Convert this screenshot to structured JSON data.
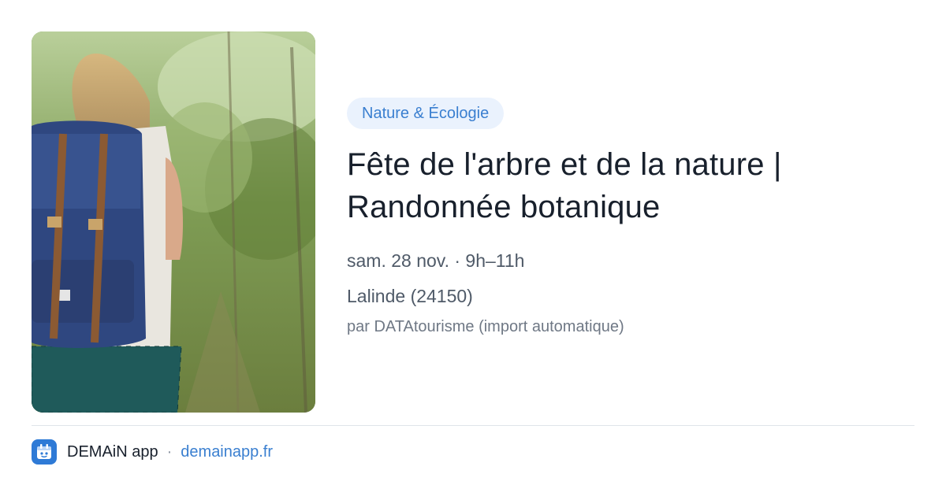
{
  "event": {
    "category": "Nature & Écologie",
    "title_line1": "Fête de l'arbre et de la nature |",
    "title_line2": "Randonnée botanique",
    "datetime": "sam. 28 nov. · 9h–11h",
    "location": "Lalinde (24150)",
    "source": "par DATAtourisme (import automatique)"
  },
  "footer": {
    "app_name": "DEMAiN app",
    "separator": "·",
    "link": "demainapp.fr"
  },
  "colors": {
    "accent": "#3a7fd0",
    "badge_bg": "#eaf2fd",
    "title": "#18202c",
    "meta": "#4f5a68",
    "logo": "#2e7ad6"
  },
  "icons": {
    "app_logo": "calendar-icon"
  }
}
